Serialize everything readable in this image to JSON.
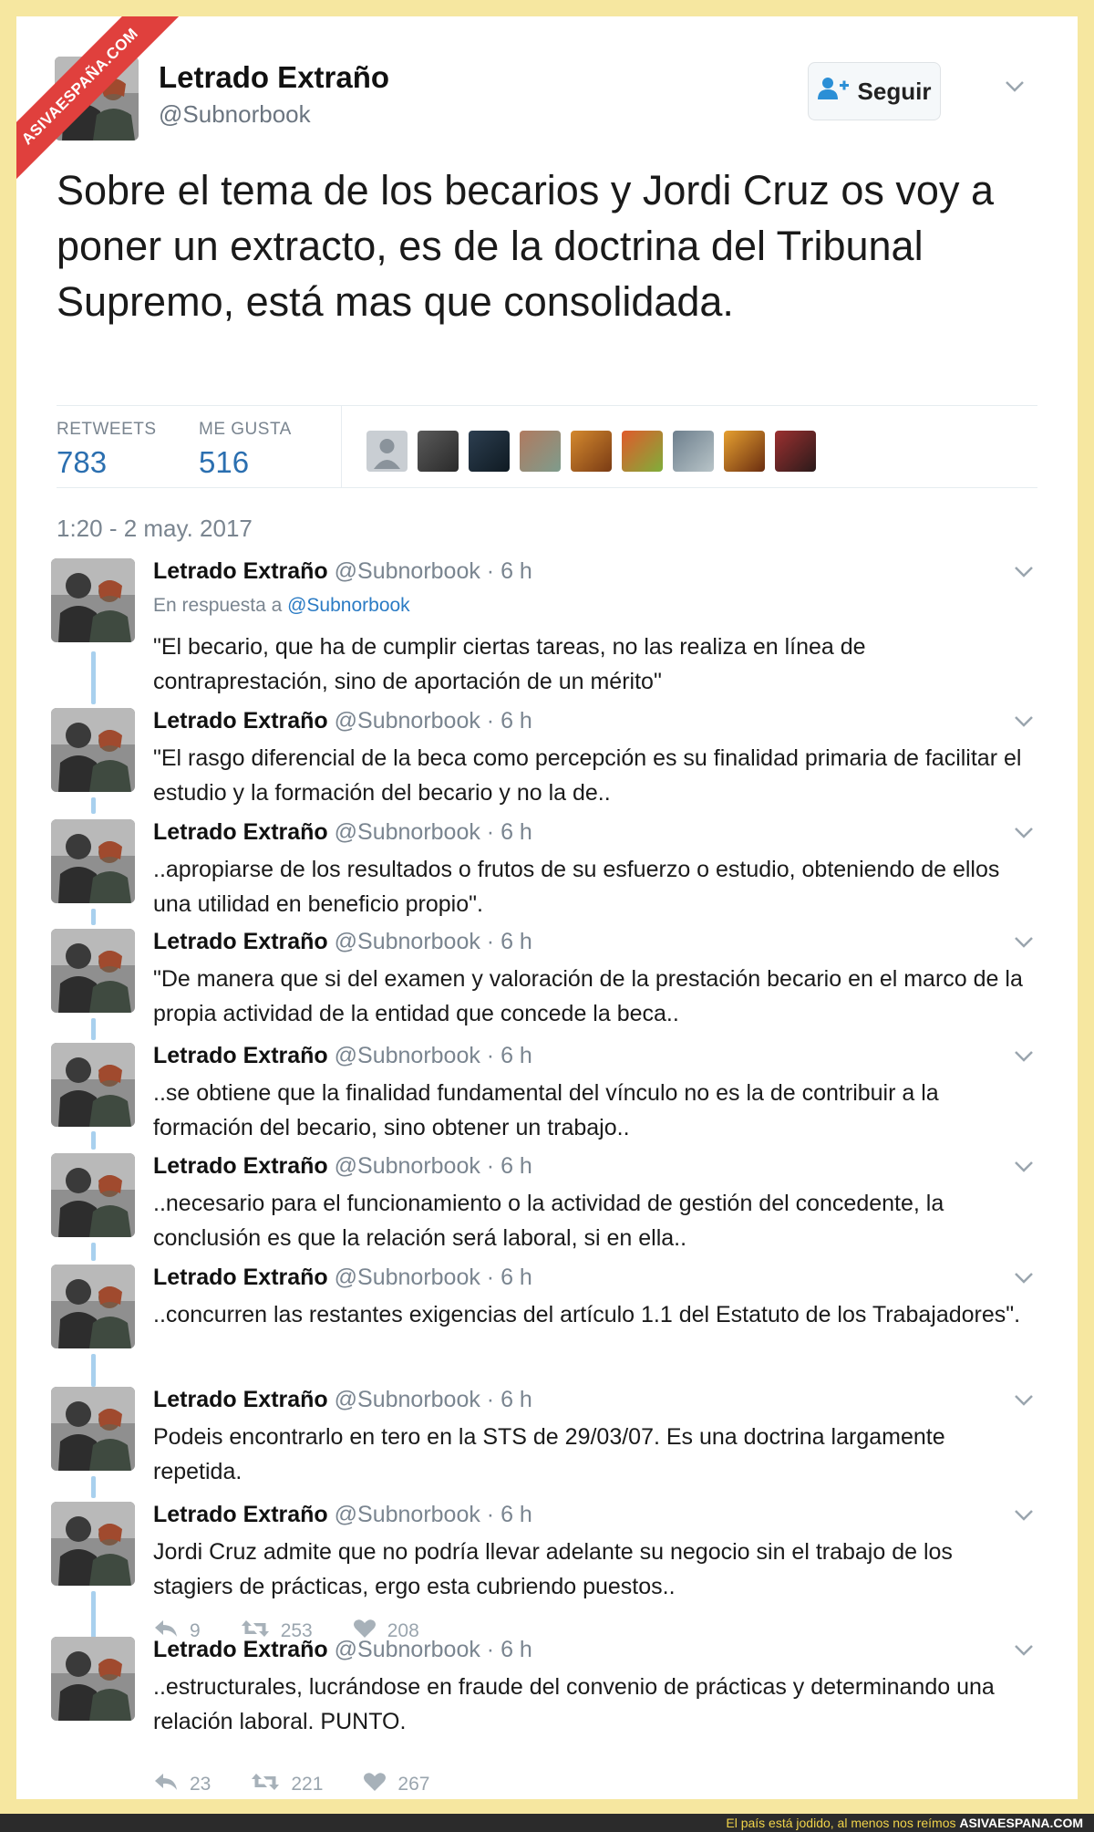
{
  "watermark": "ASIVAESPAÑA.COM",
  "tweet": {
    "author_name": "Letrado Extraño",
    "author_handle": "@Subnorbook",
    "follow_label": "Seguir",
    "text": "Sobre el tema de los becarios y Jordi Cruz os voy a poner un extracto, es de la doctrina del Tribunal Supremo, está mas que consolidada.",
    "retweets_label": "RETWEETS",
    "retweets": "783",
    "likes_label": "ME GUSTA",
    "likes": "516",
    "timestamp": "1:20 - 2 may. 2017"
  },
  "reply_meta": {
    "name": "Letrado Extraño",
    "handle_time": "@Subnorbook · 6 h",
    "in_reply_prefix": "En respuesta a",
    "in_reply_link": "@Subnorbook"
  },
  "replies": [
    {
      "text": "\"El becario, que ha de cumplir ciertas tareas, no las realiza en línea de contraprestación, sino de aportación de un mérito\""
    },
    {
      "text": "\"El  rasgo diferencial de la beca como percepción es su finalidad primaria  de facilitar el estudio y la formación del becario y no la de.."
    },
    {
      "text": "..apropiarse  de los resultados o frutos de su esfuerzo o estudio, obteniendo de ellos una utilidad en beneficio propio\"."
    },
    {
      "text": "\"De manera que si  del examen y valoración de la prestación becario en el marco de la  propia actividad de la entidad que concede la beca.."
    },
    {
      "text": "..se obtiene que la  finalidad fundamental del vínculo no es la de contribuir a la formación  del becario, sino obtener un trabajo.."
    },
    {
      "text": "..necesario para el funcionamiento o  la actividad de gestión del concedente, la conclusión es que la relación  será laboral, si en ella.."
    },
    {
      "text": "..concurren las restantes exigencias del artículo 1.1 del Estatuto de los Trabajadores\"."
    },
    {
      "text": "Podeis encontrarlo en tero en la STS de 29/03/07. Es una doctrina largamente repetida."
    },
    {
      "text": "Jordi Cruz admite que no podría llevar adelante su negocio sin el trabajo de los stagiers de prácticas, ergo esta cubriendo puestos..",
      "replies": "9",
      "retweets": "253",
      "likes": "208"
    },
    {
      "text": "..estructurales, lucrándose en fraude del convenio de prácticas y determinando una relación laboral. PUNTO.",
      "replies": "23",
      "retweets": "221",
      "likes": "267"
    }
  ],
  "footer": {
    "tagline": "El país está jodido, al menos nos reímos",
    "brand": "ASIVAESPANA.COM"
  },
  "colors": {
    "link": "#2b7bc4",
    "stat": "#2b6fb0",
    "thread": "#a8d0ee",
    "ribbon": "#e0403d",
    "frame": "#f6e7a0"
  }
}
